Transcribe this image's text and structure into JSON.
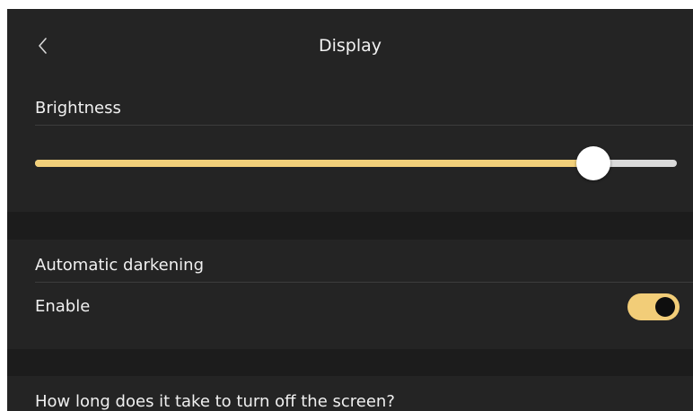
{
  "header": {
    "title": "Display",
    "back_icon": "chevron-left-icon"
  },
  "brightness": {
    "label": "Brightness",
    "value_percent": 87,
    "fill_color": "#f2d07a",
    "track_color": "#dadada"
  },
  "auto_darkening": {
    "label": "Automatic darkening",
    "enable_label": "Enable",
    "enabled": true,
    "toggle_color": "#f2cd78"
  },
  "screen_off": {
    "label": "How long does it take to turn off the screen?"
  }
}
